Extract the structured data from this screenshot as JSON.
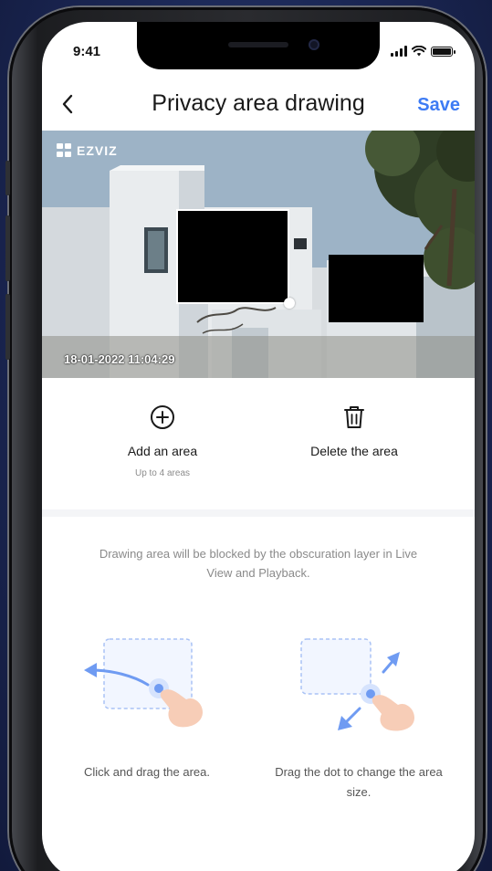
{
  "status_bar": {
    "time": "9:41"
  },
  "nav": {
    "title": "Privacy area drawing",
    "save_label": "Save"
  },
  "camera": {
    "brand": "EZVIZ",
    "timestamp": "18-01-2022 11:04:29"
  },
  "actions": {
    "add": {
      "label": "Add an area",
      "sublabel": "Up to 4 areas",
      "icon": "plus-circle-icon"
    },
    "delete": {
      "label": "Delete the area",
      "icon": "trash-icon"
    }
  },
  "hint": "Drawing area will be blocked by the obscuration layer in Live View and Playback.",
  "illustrations": {
    "drag_area": {
      "caption": "Click and drag the area."
    },
    "resize_area": {
      "caption": "Drag the dot to change the area size."
    }
  },
  "colors": {
    "accent": "#3d7bf4",
    "privacy_mask": "#000000",
    "illustration_blue": "#6f9bf2"
  }
}
